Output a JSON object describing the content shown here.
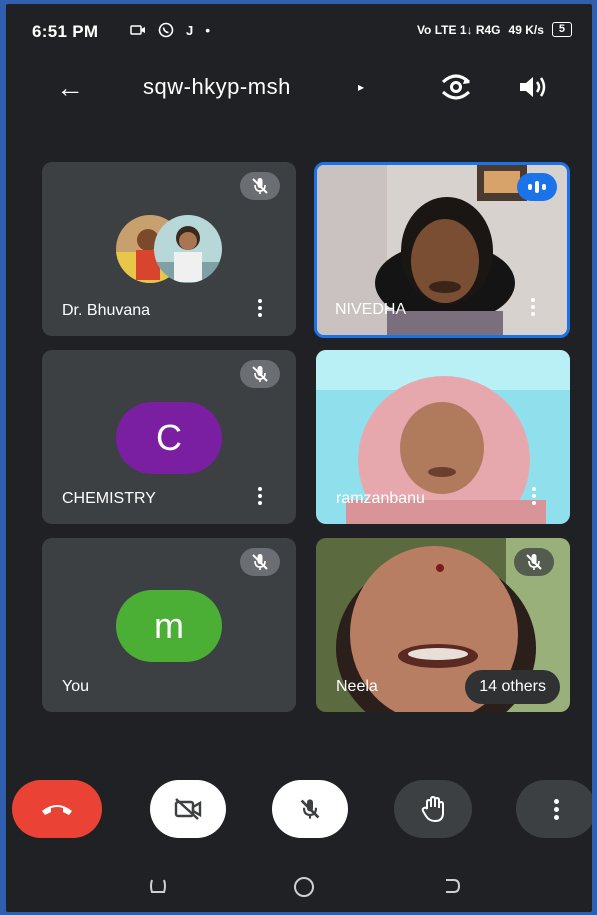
{
  "status_bar": {
    "time": "6:51 PM",
    "left_icons": [
      "video-icon",
      "whatsapp-icon",
      "j-icon",
      "dot-icon"
    ],
    "network": "Vo LTE 1↓ R4G",
    "speed": "49 K/s",
    "battery": "5"
  },
  "app_bar": {
    "meeting_code": "sqw-hkyp-msh",
    "arrow": "▸"
  },
  "participants": [
    {
      "name": "Dr. Bhuvana",
      "muted": true,
      "avatar": "photo"
    },
    {
      "name": "NIVEDHA",
      "speaking": true,
      "avatar": "video"
    },
    {
      "name": "CHEMISTRY",
      "muted": true,
      "avatar_letter": "C",
      "avatar_color": "#7b1fa2"
    },
    {
      "name": "ramzanbanu",
      "avatar": "video"
    },
    {
      "name": "You",
      "muted": true,
      "avatar_letter": "m",
      "avatar_color": "#4caf35"
    },
    {
      "name": "Neela",
      "muted": true,
      "avatar": "video",
      "others_label": "14 others"
    }
  ],
  "colors": {
    "end_call": "#ea4335",
    "accent_blue": "#1a73e8",
    "tile_bg": "#3c4043",
    "page_bg": "#202124"
  }
}
